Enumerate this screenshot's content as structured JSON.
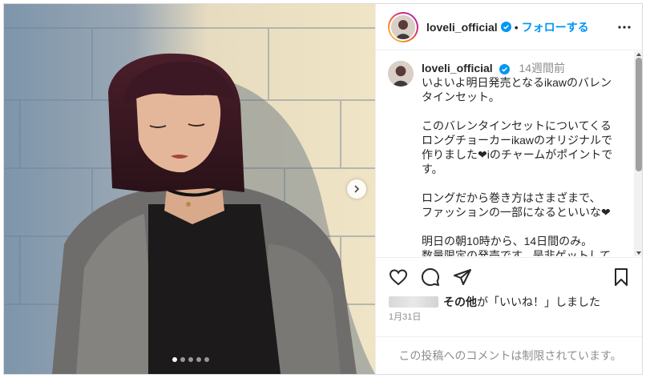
{
  "post": {
    "username": "loveli_official",
    "follow_label": "フォローする",
    "separator": "•",
    "verified_icon": "verified-badge-icon",
    "accent_color": "#0095f6",
    "carousel": {
      "slide_count": 5,
      "active_index": 0
    }
  },
  "caption": {
    "username": "loveli_official",
    "time": "14週間前",
    "lines": [
      "いよいよ明日発売となるikawのバレン",
      "タインセット。",
      "",
      "このバレンタインセットについてくる",
      "ロングチョーカーikawのオリジナルで",
      "作りました❤︎iのチャームがポイントで",
      "す。",
      "",
      "ロングだから巻き方はさまざまで、",
      "ファッションの一部になるといいな❤︎",
      "",
      "明日の朝10時から、14日間のみ。",
      "数量限定の発売です。是非ゲットして"
    ]
  },
  "likes": {
    "bold": "その他",
    "text": "が「いいね！」しました"
  },
  "date": "1月31日",
  "comments_disabled": "この投稿へのコメントは制限されています。"
}
